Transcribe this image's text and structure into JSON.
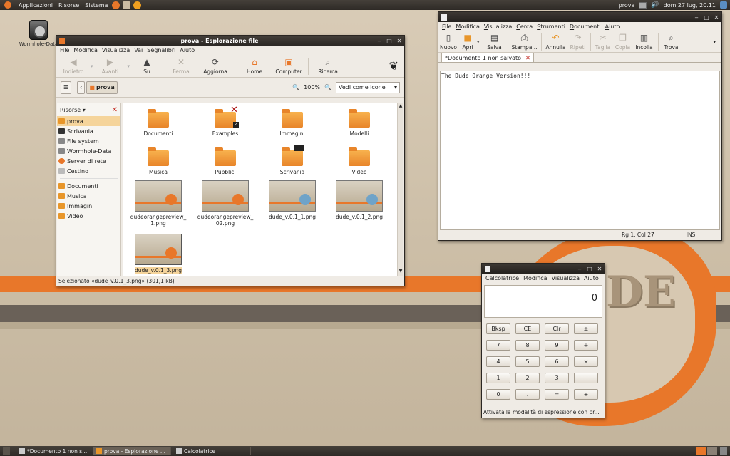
{
  "top_panel": {
    "menus": [
      "Applicazioni",
      "Risorse",
      "Sistema"
    ],
    "user": "prova",
    "datetime": "dom 27 lug, 20.11"
  },
  "desktop": {
    "icons": [
      {
        "label": "Wormhole-Data",
        "icon": "harddrive-icon"
      }
    ]
  },
  "file_manager": {
    "title": "prova - Esplorazione file",
    "menu": [
      "File",
      "Modifica",
      "Visualizza",
      "Vai",
      "Segnalibri",
      "Aiuto"
    ],
    "toolbar": [
      {
        "label": "Indietro",
        "icon": "back-icon",
        "enabled": false
      },
      {
        "label": "Avanti",
        "icon": "forward-icon",
        "enabled": false
      },
      {
        "label": "Su",
        "icon": "up-icon",
        "enabled": true
      },
      {
        "label": "Ferma",
        "icon": "stop-icon",
        "enabled": false
      },
      {
        "label": "Aggiorna",
        "icon": "reload-icon",
        "enabled": true
      },
      {
        "label": "Home",
        "icon": "home-icon",
        "enabled": true
      },
      {
        "label": "Computer",
        "icon": "computer-icon",
        "enabled": true
      },
      {
        "label": "Ricerca",
        "icon": "search-icon",
        "enabled": true
      }
    ],
    "location": "prova",
    "zoom": "100%",
    "view_mode": "Vedi come icone",
    "sidebar": {
      "header": "Risorse",
      "places": [
        {
          "label": "prova",
          "selected": true
        },
        {
          "label": "Scrivania"
        },
        {
          "label": "File system"
        },
        {
          "label": "Wormhole-Data"
        },
        {
          "label": "Server di rete"
        },
        {
          "label": "Cestino"
        }
      ],
      "bookmarks": [
        {
          "label": "Documenti"
        },
        {
          "label": "Musica"
        },
        {
          "label": "Immagini"
        },
        {
          "label": "Video"
        }
      ]
    },
    "items": [
      {
        "label": "Documenti",
        "type": "folder"
      },
      {
        "label": "Examples",
        "type": "folder-link"
      },
      {
        "label": "Immagini",
        "type": "folder"
      },
      {
        "label": "Modelli",
        "type": "folder"
      },
      {
        "label": "Musica",
        "type": "folder"
      },
      {
        "label": "Pubblici",
        "type": "folder"
      },
      {
        "label": "Scrivania",
        "type": "folder"
      },
      {
        "label": "Video",
        "type": "folder"
      },
      {
        "label": "dudeorangepreview_\n1.png",
        "type": "image"
      },
      {
        "label": "dudeorangepreview_\n02.png",
        "type": "image"
      },
      {
        "label": "dude_v.0.1_1.png",
        "type": "image"
      },
      {
        "label": "dude_v.0.1_2.png",
        "type": "image"
      },
      {
        "label": "dude_v.0.1_3.png",
        "type": "image",
        "selected": true
      }
    ],
    "status": "Selezionato «dude_v.0.1_3.png» (301,1 kB)"
  },
  "gedit": {
    "title": "",
    "menu": [
      "File",
      "Modifica",
      "Visualizza",
      "Cerca",
      "Strumenti",
      "Documenti",
      "Aiuto"
    ],
    "toolbar": [
      {
        "label": "Nuovo",
        "enabled": true
      },
      {
        "label": "Apri",
        "enabled": true
      },
      {
        "label": "Salva",
        "enabled": true
      },
      {
        "label": "Stampa...",
        "enabled": true
      },
      {
        "label": "Annulla",
        "enabled": true
      },
      {
        "label": "Ripeti",
        "enabled": false
      },
      {
        "label": "Taglia",
        "enabled": false
      },
      {
        "label": "Copia",
        "enabled": false
      },
      {
        "label": "Incolla",
        "enabled": true
      },
      {
        "label": "Trova",
        "enabled": true
      }
    ],
    "tab": "*Documento 1 non salvato",
    "content": "The Dude Orange Version!!!",
    "status_position": "Rg 1, Col 27",
    "status_mode": "INS"
  },
  "calculator": {
    "menu": [
      "Calcolatrice",
      "Modifica",
      "Visualizza",
      "Aiuto"
    ],
    "display": "0",
    "keys": [
      "Bksp",
      "CE",
      "Clr",
      "±",
      "7",
      "8",
      "9",
      "÷",
      "4",
      "5",
      "6",
      "×",
      "1",
      "2",
      "3",
      "−",
      "0",
      ".",
      "=",
      "+"
    ],
    "status": "Attivata la modalità di espressione con pr..."
  },
  "taskbar": {
    "tasks": [
      {
        "label": "*Documento 1 non s...",
        "active": false
      },
      {
        "label": "prova - Esplorazione ...",
        "active": true
      },
      {
        "label": "Calcolatrice",
        "active": false
      }
    ]
  },
  "badge_text": "DE"
}
